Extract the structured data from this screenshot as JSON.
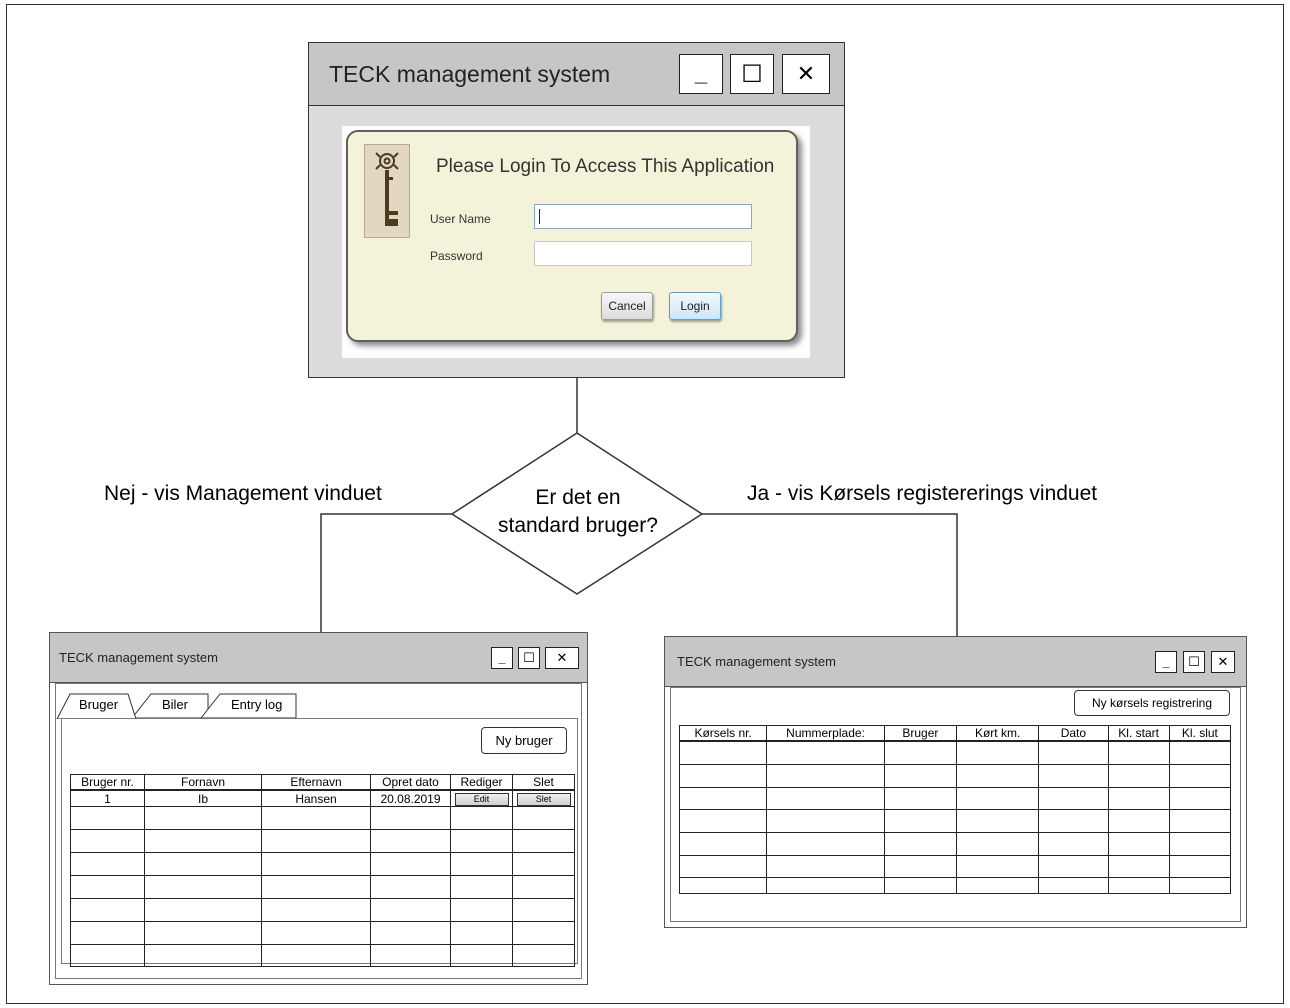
{
  "flow": {
    "decision_line1": "Er det en",
    "decision_line2": "standard bruger?",
    "no_label": "Nej - vis Management vinduet",
    "yes_label": "Ja - vis Kørsels registererings vinduet"
  },
  "login_window": {
    "title": "TECK management system",
    "controls": {
      "minimize": "_",
      "maximize": "☐",
      "close": "✕"
    },
    "heading": "Please Login To Access This Application",
    "username_label": "User Name",
    "username_value": "",
    "password_label": "Password",
    "password_value": "",
    "cancel_label": "Cancel",
    "login_label": "Login",
    "icon": "key-icon"
  },
  "management_window": {
    "title": "TECK management system",
    "tabs": [
      {
        "label": "Bruger"
      },
      {
        "label": "Biler"
      },
      {
        "label": "Entry log"
      }
    ],
    "new_user_label": "Ny bruger",
    "columns": [
      "Bruger nr.",
      "Fornavn",
      "Efternavn",
      "Opret dato",
      "Rediger",
      "Slet"
    ],
    "rows": [
      {
        "nr": "1",
        "fornavn": "Ib",
        "efternavn": "Hansen",
        "dato": "20.08.2019",
        "edit": "Edit",
        "slet": "Slet"
      }
    ]
  },
  "registration_window": {
    "title": "TECK management system",
    "new_registration_label": "Ny kørsels registrering",
    "columns": [
      "Kørsels nr.",
      "Nummerplade:",
      "Bruger",
      "Kørt km.",
      "Dato",
      "Kl. start",
      "Kl. slut"
    ]
  }
}
